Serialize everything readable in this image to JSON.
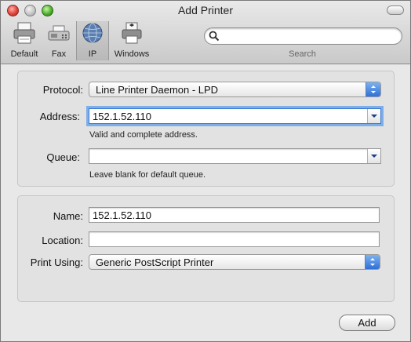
{
  "window": {
    "title": "Add Printer"
  },
  "toolbar": {
    "buttons": [
      {
        "label": "Default",
        "icon": "printer-icon"
      },
      {
        "label": "Fax",
        "icon": "fax-icon"
      },
      {
        "label": "IP",
        "icon": "globe-icon",
        "selected": true
      },
      {
        "label": "Windows",
        "icon": "windows-printer-icon"
      }
    ],
    "search": {
      "placeholder": "",
      "label": "Search"
    }
  },
  "connection": {
    "protocol": {
      "label": "Protocol:",
      "value": "Line Printer Daemon - LPD"
    },
    "address": {
      "label": "Address:",
      "value": "152.1.52.110",
      "hint": "Valid and complete address."
    },
    "queue": {
      "label": "Queue:",
      "value": "",
      "hint": "Leave blank for default queue."
    }
  },
  "details": {
    "name": {
      "label": "Name:",
      "value": "152.1.52.110"
    },
    "location": {
      "label": "Location:",
      "value": ""
    },
    "print_using": {
      "label": "Print Using:",
      "value": "Generic PostScript Printer"
    }
  },
  "actions": {
    "add_label": "Add"
  },
  "colors": {
    "accent": "#2f6fd6",
    "focus_ring": "#7eaee8"
  }
}
